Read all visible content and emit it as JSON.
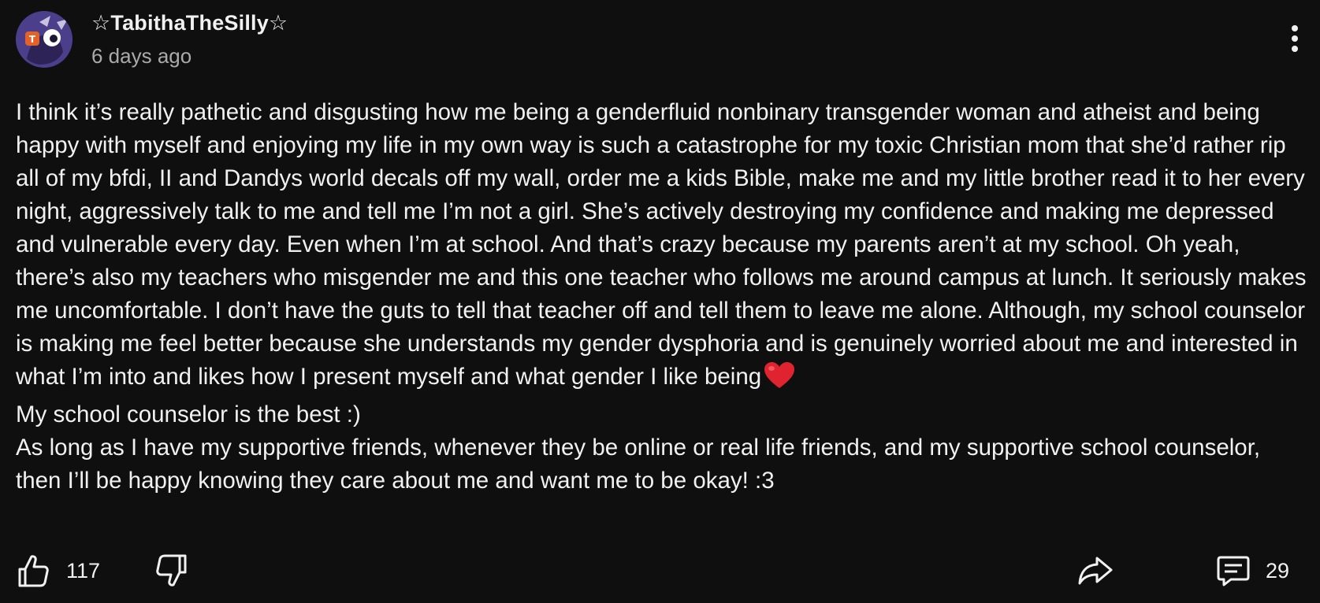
{
  "comment": {
    "author": "☆TabithaTheSilly☆",
    "timestamp": "6 days ago",
    "paragraphs": [
      "I think it’s really pathetic and disgusting how me being a genderfluid nonbinary transgender woman and atheist and being happy with myself and enjoying my life in my own way is such a catastrophe for my toxic Christian mom that she’d rather rip all of my bfdi, II and Dandys world decals off my wall, order me a kids Bible, make me and my little brother read it to her every night, aggressively talk to me and tell me I’m not a girl. She’s actively destroying my confidence and making me depressed and vulnerable every day. Even when I’m at school. And that’s crazy because my parents aren’t at my school. Oh yeah, there’s also my teachers who misgender me and this one teacher who follows me around campus at lunch. It seriously makes me uncomfortable. I don’t have the guts to tell that teacher off and tell them to leave me alone. Although, my school counselor is making me feel better because she understands my gender dysphoria and is genuinely worried about me and interested in what I’m into and likes how I present myself and what gender I like being",
      "My school counselor is the best :)",
      "As long as I have my supportive friends, whenever they be online or real life friends, and my supportive school counselor, then I’ll be happy knowing they care about me and want me to be okay! :3"
    ],
    "emoji_icon": "red-heart-icon"
  },
  "actions": {
    "like_count": "117",
    "reply_count": "29"
  },
  "icons": {
    "more": "more-vertical-icon",
    "like": "thumbs-up-icon",
    "dislike": "thumbs-down-icon",
    "share": "share-arrow-icon",
    "reply": "comment-bubble-icon"
  },
  "colors": {
    "background": "#0f0f0f",
    "text": "#f1f1f1",
    "secondary_text": "#aaaaaa",
    "heart": "#e0242f"
  }
}
